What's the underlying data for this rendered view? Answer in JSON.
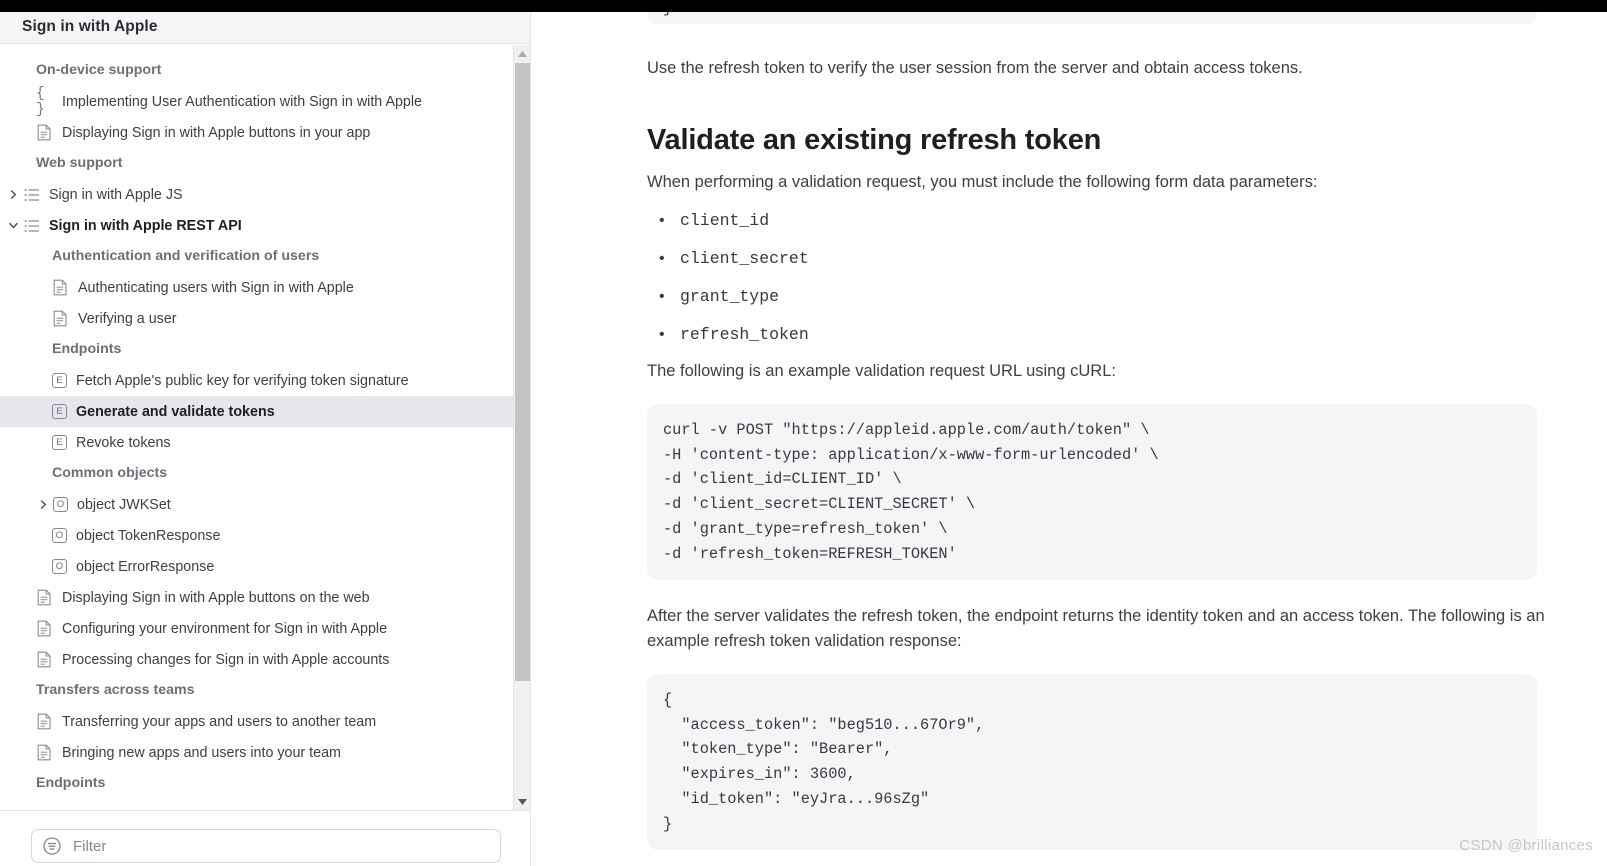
{
  "topbar": {
    "color": "#000000"
  },
  "sidebar": {
    "title": "Sign in with Apple",
    "filter": {
      "placeholder": "Filter",
      "value": "",
      "icon": "filter-circle-icon"
    },
    "scrollbar": {
      "up_icon": "caret-up-icon",
      "down_icon": "caret-down-icon"
    },
    "selected_item": "Generate and validate tokens",
    "items": [
      {
        "kind": "group",
        "label": "On-device support",
        "indent": 1
      },
      {
        "kind": "item",
        "label": "Implementing User Authentication with Sign in with Apple",
        "icon": "braces-icon",
        "indent": 1
      },
      {
        "kind": "item",
        "label": "Displaying Sign in with Apple buttons in your app",
        "icon": "document-icon",
        "indent": 1
      },
      {
        "kind": "group",
        "label": "Web support",
        "indent": 1
      },
      {
        "kind": "item",
        "label": "Sign in with Apple JS",
        "icon": "list-icon",
        "indent": 0,
        "chevron": "chevron-right-icon"
      },
      {
        "kind": "item",
        "label": "Sign in with Apple REST API",
        "icon": "list-icon",
        "indent": 0,
        "chevron": "chevron-down-icon",
        "bold": true
      },
      {
        "kind": "group",
        "label": "Authentication and verification of users",
        "indent": 2
      },
      {
        "kind": "item",
        "label": "Authenticating users with Sign in with Apple",
        "icon": "document-icon",
        "indent": 2
      },
      {
        "kind": "item",
        "label": "Verifying a user",
        "icon": "document-icon",
        "indent": 2
      },
      {
        "kind": "group",
        "label": "Endpoints",
        "indent": 2
      },
      {
        "kind": "item",
        "label": "Fetch Apple's public key for verifying token signature",
        "icon": "endpoint-badge-icon",
        "badge": "E",
        "indent": 2
      },
      {
        "kind": "item",
        "label": "Generate and validate tokens",
        "icon": "endpoint-badge-icon",
        "badge": "E",
        "indent": 2,
        "selected": true
      },
      {
        "kind": "item",
        "label": "Revoke tokens",
        "icon": "endpoint-badge-icon",
        "badge": "E",
        "indent": 2
      },
      {
        "kind": "group",
        "label": "Common objects",
        "indent": 2
      },
      {
        "kind": "item",
        "label": "object JWKSet",
        "icon": "object-badge-icon",
        "badge": "O",
        "indent": 2,
        "chevron": "chevron-right-icon"
      },
      {
        "kind": "item",
        "label": "object TokenResponse",
        "icon": "object-badge-icon",
        "badge": "O",
        "indent": 2
      },
      {
        "kind": "item",
        "label": "object ErrorResponse",
        "icon": "object-badge-icon",
        "badge": "O",
        "indent": 2
      },
      {
        "kind": "item",
        "label": "Displaying Sign in with Apple buttons on the web",
        "icon": "document-icon",
        "indent": 1
      },
      {
        "kind": "item",
        "label": "Configuring your environment for Sign in with Apple",
        "icon": "document-icon",
        "indent": 1
      },
      {
        "kind": "item",
        "label": "Processing changes for Sign in with Apple accounts",
        "icon": "document-icon",
        "indent": 1
      },
      {
        "kind": "group",
        "label": "Transfers across teams",
        "indent": 1
      },
      {
        "kind": "item",
        "label": "Transferring your apps and users to another team",
        "icon": "document-icon",
        "indent": 1
      },
      {
        "kind": "item",
        "label": "Bringing new apps and users into your team",
        "icon": "document-icon",
        "indent": 1
      },
      {
        "kind": "group",
        "label": "Endpoints",
        "indent": 1
      }
    ]
  },
  "main": {
    "code_top_line": "}",
    "intro_paragraph": "Use the refresh token to verify the user session from the server and obtain access tokens.",
    "section_heading": "Validate an existing refresh token",
    "section_paragraph": "When performing a validation request, you must include the following form data parameters:",
    "parameters": [
      "client_id",
      "client_secret",
      "grant_type",
      "refresh_token"
    ],
    "curl_intro": "The following is an example validation request URL using cURL:",
    "curl_lines": [
      "curl -v POST \"https://appleid.apple.com/auth/token\" \\",
      "-H 'content-type: application/x-www-form-urlencoded' \\",
      "-d 'client_id=CLIENT_ID' \\",
      "-d 'client_secret=CLIENT_SECRET' \\",
      "-d 'grant_type=refresh_token' \\",
      "-d 'refresh_token=REFRESH_TOKEN'"
    ],
    "response_intro": "After the server validates the refresh token, the endpoint returns the identity token and an access token. The following is an example refresh token validation response:",
    "response_lines": [
      "{",
      "  \"access_token\": \"beg510...67Or9\",",
      "  \"token_type\": \"Bearer\",",
      "  \"expires_in\": 3600,",
      "  \"id_token\": \"eyJra...96sZg\"",
      "}"
    ]
  },
  "watermark": "CSDN @brilliances"
}
